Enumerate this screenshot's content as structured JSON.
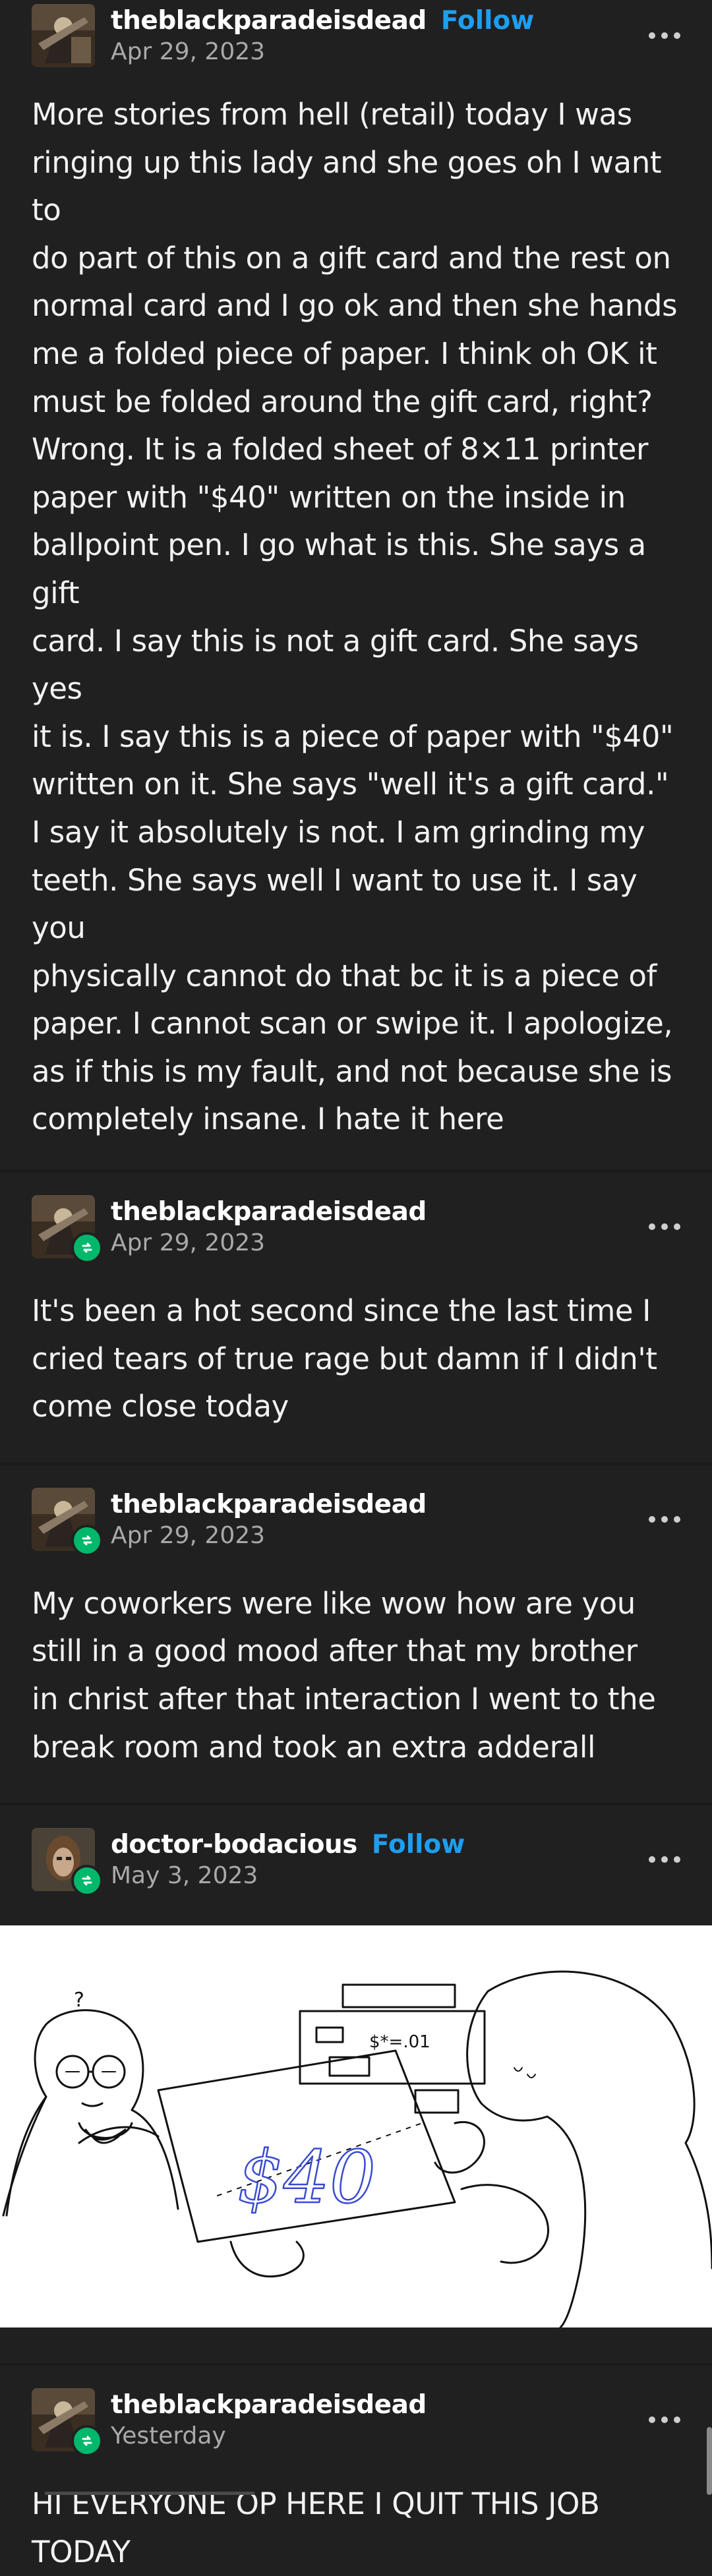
{
  "posts": [
    {
      "username": "theblackparadeisdead",
      "follow_label": "Follow",
      "date": "Apr 29, 2023",
      "text": "More stories from hell (retail) today I was\nringing up this lady and she goes oh I want to\ndo part of this on a gift card and the rest on\nnormal card and I go ok and then she hands\nme a folded piece of paper. I think oh OK it\nmust be folded around the gift card, right?\nWrong. It is a folded sheet of 8×11 printer\npaper with \"$40\" written on the inside in\nballpoint pen. I go what is this. She says a gift\ncard. I say this is not a gift card. She says yes\nit is. I say this is a piece of paper with \"$40\"\nwritten on it. She says \"well it's a gift card.\"\nI say it absolutely is not. I am grinding my\nteeth. She says well I want to use it. I say you\nphysically cannot do that bc it is a piece of\npaper. I cannot scan or swipe it. I apologize,\nas if this is my fault, and not because she is\ncompletely insane. I hate it here"
    },
    {
      "username": "theblackparadeisdead",
      "date": "Apr 29, 2023",
      "text": "It's been a hot second since the last time I\ncried tears of true rage but damn if I didn't\ncome close today"
    },
    {
      "username": "theblackparadeisdead",
      "date": "Apr 29, 2023",
      "text": "My coworkers were like wow how are you\nstill in a good mood after that my brother\nin christ after that interaction I went to the\nbreak room and took an extra adderall"
    },
    {
      "username": "doctor-bodacious",
      "follow_label": "Follow",
      "date": "May 3, 2023",
      "image_text": {
        "question_mark": "?",
        "register_display": "$*=.01",
        "paper_amount": "$40"
      }
    },
    {
      "username": "theblackparadeisdead",
      "date": "Yesterday",
      "text": "HI EVERYONE OP HERE I QUIT THIS JOB\nTODAY"
    }
  ],
  "icons": {
    "more": "more-options-icon",
    "reblog": "reblog-icon"
  },
  "colors": {
    "background": "#202020",
    "follow": "#1e9ef0",
    "reblog_badge": "#00b86b",
    "date": "#a9a9a9"
  }
}
